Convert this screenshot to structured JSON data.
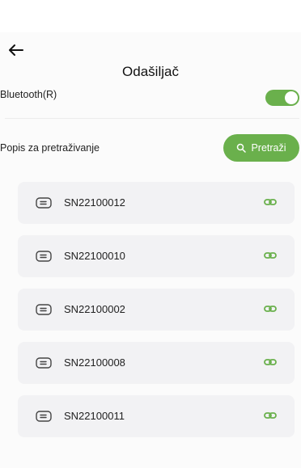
{
  "header": {
    "title": "Odašiljač"
  },
  "bluetooth": {
    "label": "Bluetooth(R)",
    "enabled": true
  },
  "search": {
    "list_label": "Popis za pretraživanje",
    "button_label": "Pretraži"
  },
  "devices": [
    {
      "name": "SN22100012"
    },
    {
      "name": "SN22100010"
    },
    {
      "name": "SN22100002"
    },
    {
      "name": "SN22100008"
    },
    {
      "name": "SN22100011"
    }
  ],
  "colors": {
    "accent": "#6ab04c",
    "card": "#f2f2f4"
  },
  "icons": {
    "back": "arrow-left-icon",
    "search": "search-icon",
    "device": "device-icon",
    "link": "link-icon"
  }
}
